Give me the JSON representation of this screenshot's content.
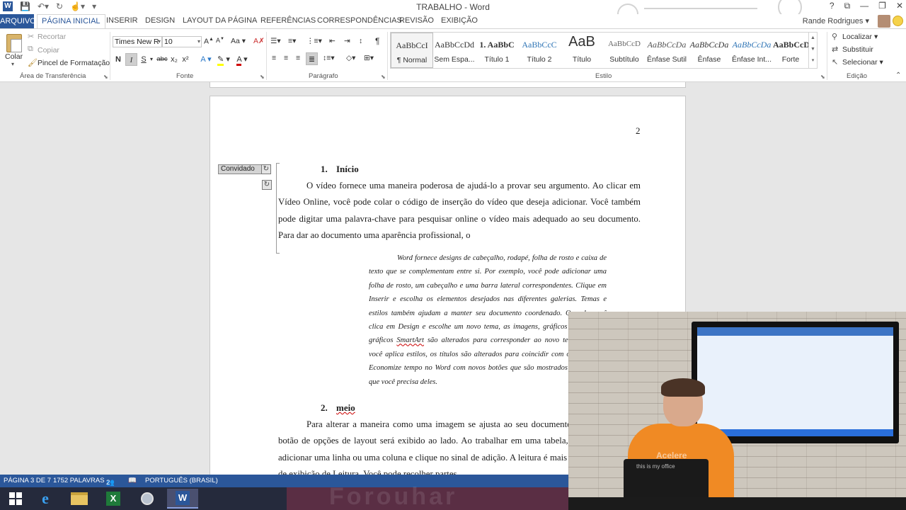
{
  "window": {
    "title": "TRABALHO - Word",
    "controls": [
      "?",
      "⧉",
      "—",
      "❐",
      "✕"
    ]
  },
  "tabs": {
    "file": "ARQUIVO",
    "items": [
      "PÁGINA INICIAL",
      "INSERIR",
      "DESIGN",
      "LAYOUT DA PÁGINA",
      "REFERÊNCIAS",
      "CORRESPONDÊNCIAS",
      "REVISÃO",
      "EXIBIÇÃO"
    ],
    "active": "PÁGINA INICIAL",
    "user": "Rande Rodrigues"
  },
  "ribbon": {
    "clipboard": {
      "paste": "Colar",
      "cut": "Recortar",
      "copy": "Copiar",
      "format_painter": "Pincel de Formatação",
      "label": "Área de Transferência"
    },
    "font": {
      "name": "Times New R",
      "size": "10",
      "bold": "N",
      "italic": "I",
      "underline": "S",
      "strike": "abc",
      "subscript": "x₂",
      "superscript": "x²",
      "label": "Fonte",
      "italic_active": true,
      "highlight_color": "#ffff00",
      "font_color": "#d00000"
    },
    "paragraph": {
      "label": "Parágrafo"
    },
    "styles": {
      "label": "Estilo",
      "items": [
        {
          "preview": "AaBbCcI",
          "name": "¶ Normal"
        },
        {
          "preview": "AaBbCcDd",
          "name": "Sem Espa..."
        },
        {
          "preview": "1. AaBbC",
          "name": "Título 1"
        },
        {
          "preview": "AaBbCcC",
          "name": "Título 2"
        },
        {
          "preview": "AaB",
          "name": "Título"
        },
        {
          "preview": "AaBbCcD",
          "name": "Subtítulo"
        },
        {
          "preview": "AaBbCcDa",
          "name": "Ênfase Sutil"
        },
        {
          "preview": "AaBbCcDa",
          "name": "Ênfase"
        },
        {
          "preview": "AaBbCcDa",
          "name": "Ênfase Int..."
        },
        {
          "preview": "AaBbCcD",
          "name": "Forte"
        }
      ]
    },
    "editing": {
      "find": "Localizar",
      "replace": "Substituir",
      "select": "Selecionar",
      "label": "Edição"
    }
  },
  "document": {
    "page_number": "2",
    "coauthor_tag": "Convidado",
    "section1": {
      "number": "1.",
      "title": "Início",
      "paragraph": "O vídeo fornece uma maneira poderosa de ajudá-lo a provar seu argumento. Ao clicar em Vídeo Online, você pode colar o código de inserção do vídeo que deseja adicionar. Você também pode digitar uma palavra-chave para pesquisar online o vídeo mais adequado ao seu documento. Para dar ao documento uma aparência profissional, o"
    },
    "quote": {
      "part1": "Word fornece designs de cabeçalho, rodapé, folha de rosto e caixa de texto que se complementam entre si. Por exemplo, você pode adicionar uma folha de rosto, um cabeçalho e uma barra lateral correspondentes. Clique em Inserir e escolha os elementos desejados nas diferentes galerias. Temas e estilos também ajudam a manter seu documento coordenado. Quando você clica em Design e escolhe um novo tema, as imagens, gráficos e elementos gráficos ",
      "smartart": "SmartArt",
      "part2": " são alterados para corresponder ao novo tema. Quando você aplica estilos, os títulos são alterados para coincidir com o novo tema. Economize tempo no Word com novos botões que são mostrados no local em que você precisa deles."
    },
    "section2": {
      "number": "2.",
      "title": "meio",
      "paragraph": "Para alterar a maneira como uma imagem se ajusta ao seu documento, clique nela e um botão de opções de layout será exibido ao lado. Ao trabalhar em uma tabela, clique onde deseja adicionar uma linha ou uma coluna e clique no sinal de adição. A leitura é mais fácil no novo modo de exibição de Leitura. Você pode recolher partes"
    }
  },
  "statusbar": {
    "page": "PÁGINA 3 DE 7",
    "words": "1752 PALAVRAS",
    "authors": "2",
    "language": "PORTUGUÊS (BRASIL)"
  },
  "taskbar": {
    "items": [
      "start",
      "internet-explorer",
      "file-explorer",
      "excel",
      "app",
      "word"
    ],
    "active": "word",
    "banner_text": "Forouhar"
  },
  "webcam": {
    "laptop_text": "this is my office",
    "shirt_text": "Acelere"
  },
  "colors": {
    "accent": "#2b579a",
    "ribbon_bg": "#ffffff",
    "workspace_bg": "#e6e6e6",
    "taskbar_bg": "#252a3c"
  }
}
